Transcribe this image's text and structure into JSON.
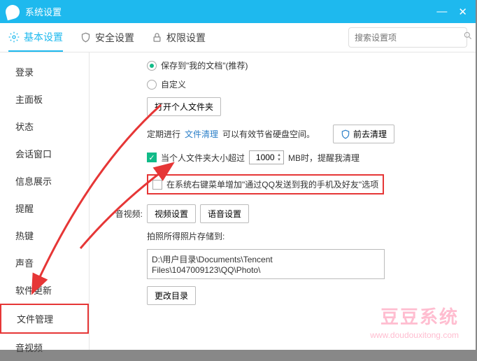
{
  "titlebar": {
    "title": "系统设置"
  },
  "tabs": {
    "basic": "基本设置",
    "safety": "安全设置",
    "perm": "权限设置",
    "search_placeholder": "搜索设置项"
  },
  "sidebar": {
    "items": [
      "登录",
      "主面板",
      "状态",
      "会话窗口",
      "信息展示",
      "提醒",
      "热键",
      "声音",
      "软件更新",
      "文件管理",
      "音视频"
    ]
  },
  "main": {
    "radio_docs": "保存到\"我的文档\"(推荐)",
    "radio_custom": "自定义",
    "open_folder_btn": "打开个人文件夹",
    "clean_prefix": "定期进行",
    "clean_link": "文件清理",
    "clean_suffix": "可以有效节省硬盘空间。",
    "go_clean_btn": "前去清理",
    "folder_exceed_label": "当个人文件夹大小超过",
    "folder_value": "1000",
    "folder_unit_after": "MB时，提醒我清理",
    "rightclick_option": "在系统右键菜单增加\"通过QQ发送到我的手机及好友\"选项",
    "av_label": "音视频:",
    "video_btn": "视频设置",
    "audio_btn": "语音设置",
    "photo_save_label": "拍照所得照片存储到:",
    "photo_path": "D:\\用户目录\\Documents\\Tencent Files\\1047009123\\QQ\\Photo\\",
    "change_dir_btn": "更改目录"
  },
  "watermark": {
    "big": "豆豆系统",
    "url": "www.doudouxitong.com"
  }
}
